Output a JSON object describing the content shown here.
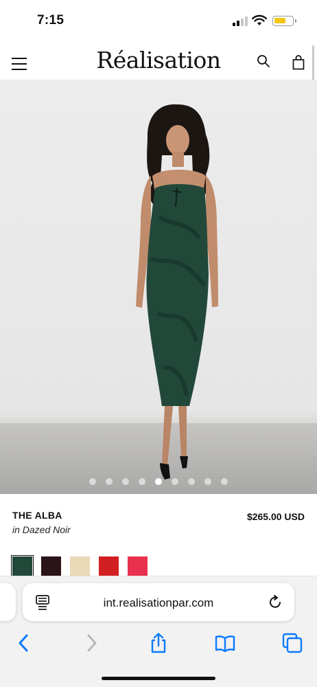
{
  "status_bar": {
    "time": "7:15"
  },
  "header": {
    "logo": "Réalisation"
  },
  "hero": {
    "slide_count": 9,
    "active_slide": 5
  },
  "product": {
    "name": "THE ALBA",
    "color": "in Dazed Noir",
    "price": "$265.00 USD"
  },
  "swatches": [
    {
      "name": "swatch-dazed-noir",
      "color": "#22483a",
      "active": true
    },
    {
      "name": "swatch-red-dots",
      "color": "#2a1418"
    },
    {
      "name": "swatch-floral-cream",
      "color": "#e9d9b6"
    },
    {
      "name": "swatch-red-print",
      "color": "#d21f22"
    },
    {
      "name": "swatch-pink-print",
      "color": "#e9304e"
    }
  ],
  "browser": {
    "url": "int.realisationpar.com"
  },
  "colors": {
    "ios_blue": "#0a7aff",
    "battery": "#f5c518"
  },
  "icons": [
    "menu-icon",
    "search-icon",
    "bag-icon",
    "reader-icon",
    "reload-icon",
    "back-icon",
    "forward-icon",
    "share-icon",
    "bookmarks-icon",
    "tabs-icon"
  ]
}
